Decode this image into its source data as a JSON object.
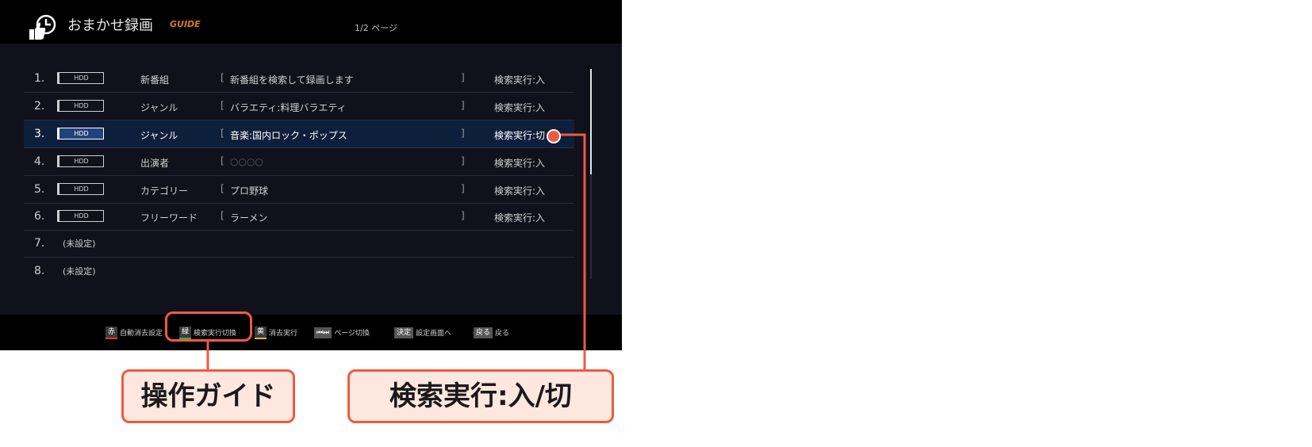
{
  "header": {
    "title": "おまかせ録画",
    "brand_logo": "GUIDE",
    "page_indicator": "1/2 ページ"
  },
  "rows": [
    {
      "num": "1.",
      "hdd": "HDD",
      "type": "新番組",
      "bracket_open": "[",
      "condition": "新番組を検索して録画します",
      "bracket_close": "]",
      "status": "検索実行:入"
    },
    {
      "num": "2.",
      "hdd": "HDD",
      "type": "ジャンル",
      "bracket_open": "[",
      "condition": "バラエティ:料理バラエティ",
      "bracket_close": "]",
      "status": "検索実行:入"
    },
    {
      "num": "3.",
      "hdd": "HDD",
      "type": "ジャンル",
      "bracket_open": "[",
      "condition": "音楽:国内ロック・ポップス",
      "bracket_close": "]",
      "status": "検索実行:切"
    },
    {
      "num": "4.",
      "hdd": "HDD",
      "type": "出演者",
      "bracket_open": "[",
      "condition": "○○○○",
      "bracket_close": "]",
      "status": "検索実行:入"
    },
    {
      "num": "5.",
      "hdd": "HDD",
      "type": "カテゴリー",
      "bracket_open": "[",
      "condition": "プロ野球",
      "bracket_close": "]",
      "status": "検索実行:入"
    },
    {
      "num": "6.",
      "hdd": "HDD",
      "type": "フリーワード",
      "bracket_open": "[",
      "condition": "ラーメン",
      "bracket_close": "]",
      "status": "検索実行:入"
    },
    {
      "num": "7.",
      "unset": "(未設定)"
    },
    {
      "num": "8.",
      "unset": "(未設定)"
    }
  ],
  "guide": {
    "red_key": "赤",
    "red_label": "自動消去設定",
    "green_key": "緑",
    "green_label": "検索実行切換",
    "yellow_key": "黄",
    "yellow_label": "消去実行",
    "page_key": "⏮⏭",
    "page_label": "ページ切換",
    "enter_key": "決定",
    "enter_label": "設定画面へ",
    "back_key": "戻る",
    "back_label": "戻る"
  },
  "callouts": {
    "guide_label": "操作ガイド",
    "search_label": "検索実行:入/切"
  },
  "colors": {
    "accent": "#ee5a42",
    "selected_row": "#0e1f3c",
    "screen_bg": "#11111b"
  }
}
